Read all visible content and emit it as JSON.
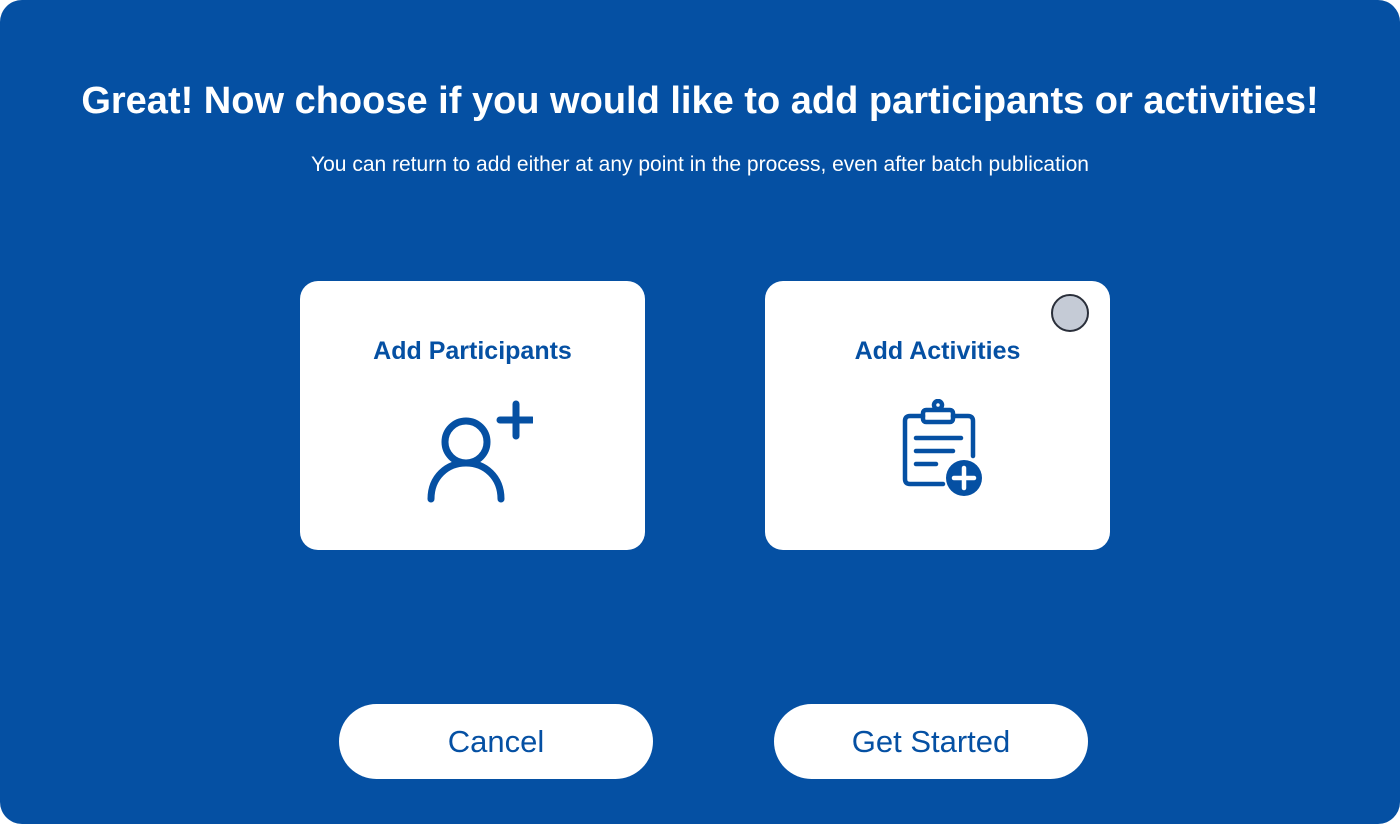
{
  "dialog": {
    "title": "Great! Now choose if you would like to add participants or activities!",
    "subtitle": "You can return to add either at any point in the process, even after batch publication"
  },
  "options": [
    {
      "label": "Add Participants",
      "icon": "user-add-icon",
      "selected": false
    },
    {
      "label": "Add Activities",
      "icon": "clipboard-add-icon",
      "selected": false
    }
  ],
  "actions": {
    "cancel_label": "Cancel",
    "start_label": "Get Started"
  },
  "colors": {
    "background": "#0550A3",
    "surface": "#FFFFFF",
    "accent": "#0550A3",
    "radio_fill": "#C5CBD6"
  }
}
